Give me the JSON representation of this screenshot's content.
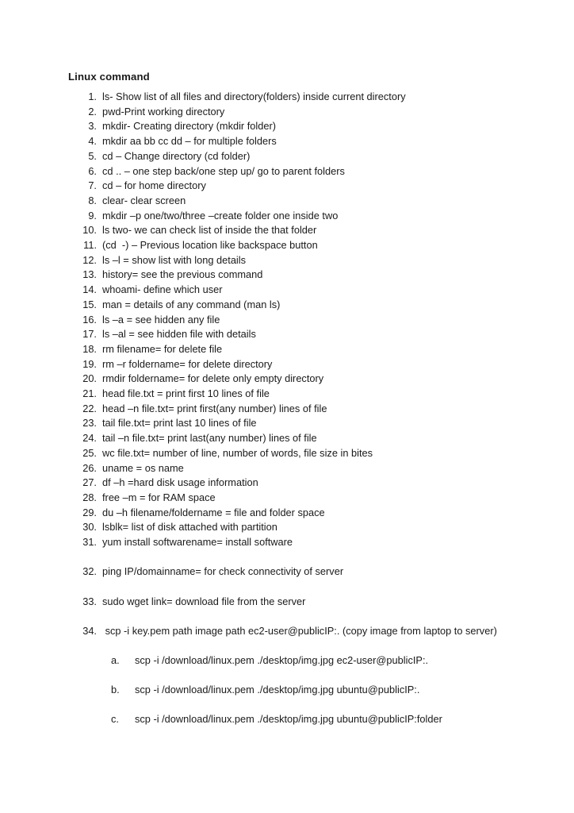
{
  "document": {
    "heading": "Linux command",
    "page_background": "#ffffff",
    "text_color": "#1a1a1a"
  },
  "list": {
    "items": [
      {
        "marker": "1.",
        "text": "ls- Show list of all files and directory(folders) inside current directory",
        "spaced": false
      },
      {
        "marker": "2.",
        "text": "pwd-Print working directory",
        "spaced": false
      },
      {
        "marker": "3.",
        "text": "mkdir- Creating directory (mkdir folder)",
        "spaced": false
      },
      {
        "marker": "4.",
        "text": "mkdir aa bb cc dd – for multiple folders",
        "spaced": false
      },
      {
        "marker": "5.",
        "text": "cd – Change directory (cd folder)",
        "spaced": false
      },
      {
        "marker": "6.",
        "text": "cd .. – one step back/one step up/ go to parent folders",
        "spaced": false
      },
      {
        "marker": "7.",
        "text": "cd – for home directory",
        "spaced": false
      },
      {
        "marker": "8.",
        "text": "clear- clear screen",
        "spaced": false
      },
      {
        "marker": "9.",
        "text": "mkdir –p one/two/three –create folder one inside two",
        "spaced": false
      },
      {
        "marker": "10.",
        "text": "ls two- we can check list of inside the that folder",
        "spaced": false
      },
      {
        "marker": "11.",
        "text": "(cd  -) – Previous location like backspace button",
        "spaced": false
      },
      {
        "marker": "12.",
        "text": "ls –l = show list with long details",
        "spaced": false
      },
      {
        "marker": "13.",
        "text": "history= see the previous command",
        "spaced": false
      },
      {
        "marker": "14.",
        "text": "whoami- define which user",
        "spaced": false
      },
      {
        "marker": "15.",
        "text": "man = details of any command (man ls)",
        "spaced": false
      },
      {
        "marker": "16.",
        "text": "ls –a = see hidden any file",
        "spaced": false
      },
      {
        "marker": "17.",
        "text": "ls –al = see hidden file with details",
        "spaced": false
      },
      {
        "marker": "18.",
        "text": "rm filename= for delete file",
        "spaced": false
      },
      {
        "marker": "19.",
        "text": "rm –r foldername= for delete directory",
        "spaced": false
      },
      {
        "marker": "20.",
        "text": "rmdir foldername= for delete only empty directory",
        "spaced": false
      },
      {
        "marker": "21.",
        "text": "head file.txt = print first 10 lines of file",
        "spaced": false
      },
      {
        "marker": "22.",
        "text": "head –n file.txt= print first(any number) lines of file",
        "spaced": false
      },
      {
        "marker": "23.",
        "text": "tail file.txt= print last 10 lines of file",
        "spaced": false
      },
      {
        "marker": "24.",
        "text": "tail –n file.txt= print last(any number) lines of file",
        "spaced": false
      },
      {
        "marker": "25.",
        "text": "wc file.txt= number of line, number of words, file size in bites",
        "spaced": false
      },
      {
        "marker": "26.",
        "text": "uname = os name",
        "spaced": false
      },
      {
        "marker": "27.",
        "text": "df –h =hard disk usage information",
        "spaced": false
      },
      {
        "marker": "28.",
        "text": "free –m = for RAM space",
        "spaced": false
      },
      {
        "marker": "29.",
        "text": "du –h filename/foldername = file and folder space",
        "spaced": false
      },
      {
        "marker": "30.",
        "text": "lsblk= list of disk attached with partition",
        "spaced": false
      },
      {
        "marker": "31.",
        "text": "yum install softwarename= install software",
        "spaced": false
      },
      {
        "marker": "32.",
        "text": "ping IP/domainname= for check connectivity of server",
        "spaced": true
      },
      {
        "marker": "33.",
        "text": "sudo wget link= download file from the server",
        "spaced": true
      },
      {
        "marker": "34.",
        "text": " scp -i key.pem path image path ec2-user@publicIP:. (copy image from laptop to server)",
        "spaced": true
      }
    ],
    "subitems": [
      {
        "marker": "a.",
        "text": "scp -i /download/linux.pem ./desktop/img.jpg ec2-user@publicIP:."
      },
      {
        "marker": "b.",
        "text": "scp -i /download/linux.pem ./desktop/img.jpg ubuntu@publicIP:."
      },
      {
        "marker": "c.",
        "text": "scp -i /download/linux.pem ./desktop/img.jpg ubuntu@publicIP:folder"
      }
    ]
  }
}
